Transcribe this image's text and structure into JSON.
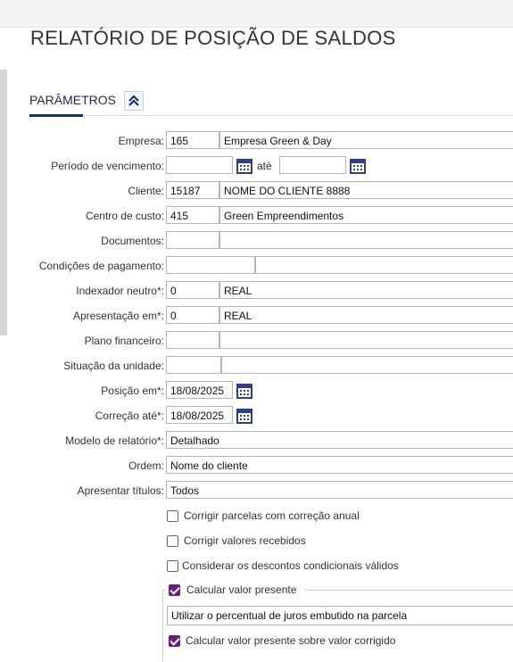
{
  "page": {
    "title": "RELATÓRIO DE POSIÇÃO DE SALDOS"
  },
  "params": {
    "label": "PARÂMETROS"
  },
  "fields": {
    "empresa": {
      "label": "Empresa:",
      "code": "165",
      "name": "Empresa Green & Day"
    },
    "periodo": {
      "label": "Período de vencimento:",
      "from": "",
      "ate": "até",
      "to": ""
    },
    "cliente": {
      "label": "Cliente:",
      "code": "15187",
      "name": "NOME DO CLIENTE 8888"
    },
    "centro_custo": {
      "label": "Centro de custo:",
      "code": "415",
      "name": "Green Empreendimentos"
    },
    "documentos": {
      "label": "Documentos:",
      "code": "",
      "name": ""
    },
    "condicoes": {
      "label": "Condições de pagamento:",
      "code": "",
      "name": ""
    },
    "indexador": {
      "label": "Indexador neutro*:",
      "code": "0",
      "name": "REAL"
    },
    "apresentacao": {
      "label": "Apresentação em*:",
      "code": "0",
      "name": "REAL"
    },
    "plano": {
      "label": "Plano financeiro:",
      "code": "",
      "name": ""
    },
    "situacao": {
      "label": "Situação da unidade:",
      "code": "",
      "name": ""
    },
    "posicao": {
      "label": "Posição em*:",
      "value": "18/08/2025"
    },
    "correcao": {
      "label": "Correção até*:",
      "value": "18/08/2025"
    },
    "modelo": {
      "label": "Modelo de relatório*:",
      "value": "Detalhado"
    },
    "ordem": {
      "label": "Ordem:",
      "value": "Nome do cliente"
    },
    "titulos": {
      "label": "Apresentar títulos:",
      "value": "Todos"
    }
  },
  "checkboxes": {
    "corrigir_parcelas": {
      "label": "Corrigir parcelas com correção anual",
      "checked": false
    },
    "corrigir_valores": {
      "label": "Corrigir valores recebidos",
      "checked": false
    },
    "descontos": {
      "label": "Considerar os descontos condicionais válidos",
      "checked": false
    },
    "valor_presente": {
      "label": "Calcular valor presente",
      "checked": true
    },
    "valor_corrigido": {
      "label": "Calcular valor presente sobre valor corrigido",
      "checked": true
    }
  },
  "valor_presente": {
    "juros_option": "Utilizar o percentual de juros embutido na parcela"
  },
  "colors": {
    "accent": "#1e2e66",
    "checkbox": "#6a1f7a",
    "calendar": "#2b3f8c"
  }
}
